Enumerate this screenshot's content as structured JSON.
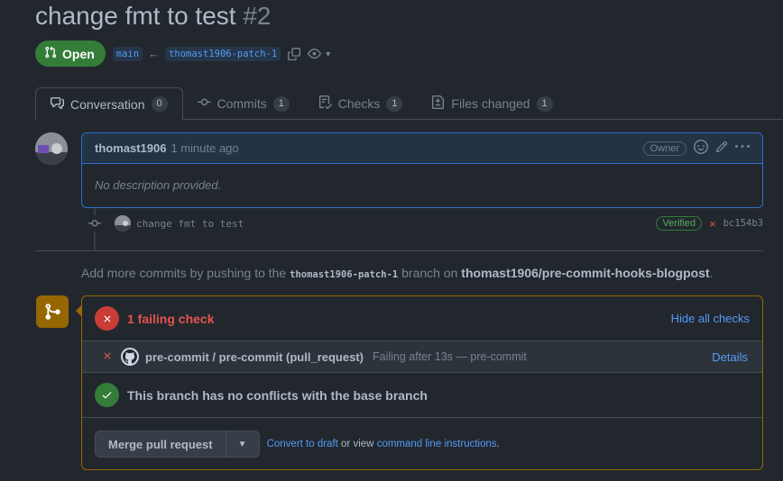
{
  "pr": {
    "title": "change fmt to test",
    "number": "#2",
    "state": "Open",
    "base_branch": "main",
    "head_branch": "thomast1906-patch-1",
    "arrow": "←"
  },
  "tabs": [
    {
      "label": "Conversation",
      "count": "0"
    },
    {
      "label": "Commits",
      "count": "1"
    },
    {
      "label": "Checks",
      "count": "1"
    },
    {
      "label": "Files changed",
      "count": "1"
    }
  ],
  "comment": {
    "author": "thomast1906",
    "time": "1 minute ago",
    "role": "Owner",
    "body": "No description provided."
  },
  "commit": {
    "message": "change fmt to test",
    "verified": "Verified",
    "status_icon": "×",
    "sha": "bc154b3"
  },
  "hint": {
    "prefix": "Add more commits by pushing to the",
    "branch": "thomast1906-patch-1",
    "middle": "branch on",
    "repo": "thomast1906/pre-commit-hooks-blogpost",
    "suffix": "."
  },
  "merge": {
    "failing_summary": "1 failing check",
    "hide_checks": "Hide all checks",
    "check_name": "pre-commit / pre-commit (pull_request)",
    "check_status": "Failing after 13s — pre-commit",
    "details": "Details",
    "no_conflicts": "This branch has no conflicts with the base branch",
    "merge_button": "Merge pull request",
    "convert_draft": "Convert to draft",
    "or_view": "or view",
    "command_line": "command line instructions",
    "period": "."
  },
  "colors": {
    "open_green": "#347d39",
    "link_blue": "#539bf5",
    "fail_red": "#e5534b",
    "merge_orange": "#966600"
  },
  "icons": [
    "git-pull-request-icon",
    "arrow-left-icon",
    "copy-icon",
    "eye-icon",
    "comment-discussion-icon",
    "git-commit-icon",
    "checklist-icon",
    "file-diff-icon",
    "smiley-icon",
    "pencil-icon",
    "kebab-icon",
    "x-icon",
    "check-icon",
    "github-icon",
    "git-branch-icon",
    "triangle-down-icon"
  ]
}
